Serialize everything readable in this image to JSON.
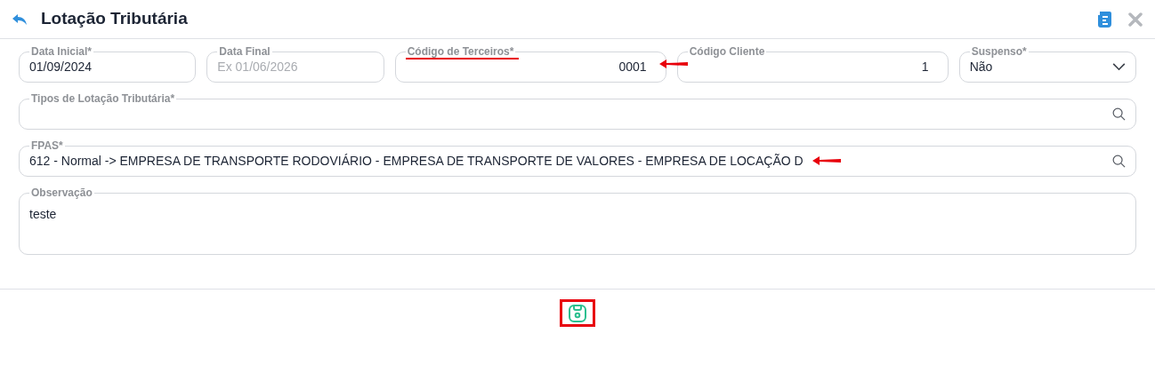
{
  "window": {
    "title": "Lotação Tributária"
  },
  "rows": [
    {
      "fields": [
        {
          "kind": "text",
          "label": "Data Inicial*",
          "value": "01/09/2024"
        },
        {
          "kind": "text",
          "label": "Data Final",
          "placeholder": "Ex 01/06/2026"
        },
        {
          "kind": "number",
          "label": "Código de Terceiros*",
          "value": "0001",
          "label_underlined": true,
          "arrow": true
        },
        {
          "kind": "number",
          "label": "Código Cliente",
          "value": "1"
        },
        {
          "kind": "select",
          "label": "Suspenso*",
          "value": "Não"
        }
      ]
    },
    {
      "fields": [
        {
          "kind": "search",
          "label": "Tipos de Lotação Tributária*"
        }
      ]
    },
    {
      "fields": [
        {
          "kind": "search",
          "label": "FPAS*",
          "value": "612 - Normal -> EMPRESA DE TRANSPORTE RODOVIÁRIO - EMPRESA DE TRANSPORTE DE VALORES - EMPRESA DE LOCAÇÃO D",
          "arrow": true
        }
      ]
    },
    {
      "fields": [
        {
          "kind": "textarea",
          "label": "Observação",
          "value": "teste"
        }
      ]
    }
  ],
  "save_button": {
    "highlighted": true
  }
}
